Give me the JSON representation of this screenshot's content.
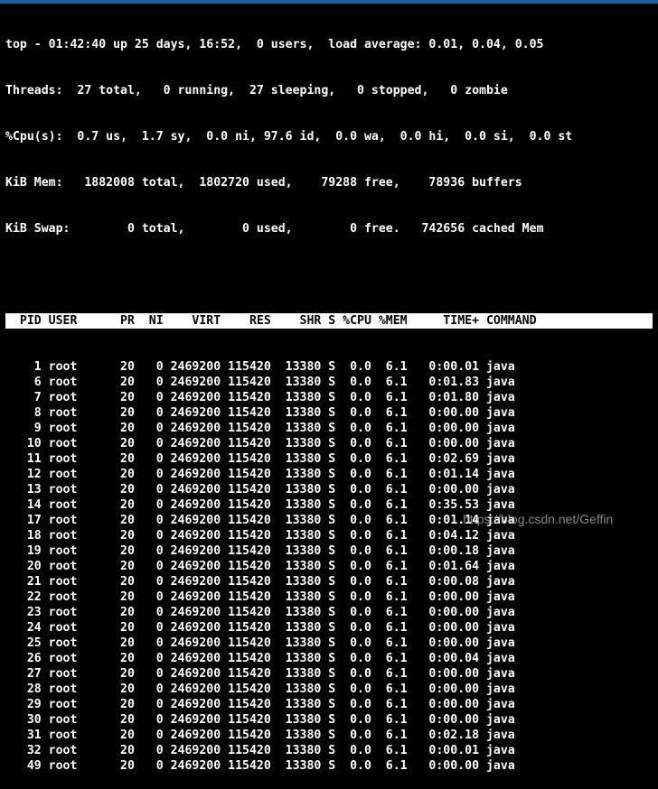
{
  "colors": {
    "background": "#000000",
    "text": "#ffffff",
    "header_bg": "#ffffff",
    "header_text": "#000000",
    "window_bar": "#1a5fa6"
  },
  "summary": [
    "top - 01:42:40 up 25 days, 16:52,  0 users,  load average: 0.01, 0.04, 0.05",
    "Threads:  27 total,   0 running,  27 sleeping,   0 stopped,   0 zombie",
    "%Cpu(s):  0.7 us,  1.7 sy,  0.0 ni, 97.6 id,  0.0 wa,  0.0 hi,  0.0 si,  0.0 st",
    "KiB Mem:   1882008 total,  1802720 used,    79288 free,    78936 buffers",
    "KiB Swap:        0 total,        0 used,        0 free.   742656 cached Mem"
  ],
  "table": {
    "header": "  PID USER      PR  NI    VIRT    RES    SHR S %CPU %MEM     TIME+ COMMAND",
    "rows": [
      [
        "1",
        "root",
        "20",
        "0",
        "2469200",
        "115420",
        "13380",
        "S",
        "0.0",
        "6.1",
        "0:00.01",
        "java"
      ],
      [
        "6",
        "root",
        "20",
        "0",
        "2469200",
        "115420",
        "13380",
        "S",
        "0.0",
        "6.1",
        "0:01.83",
        "java"
      ],
      [
        "7",
        "root",
        "20",
        "0",
        "2469200",
        "115420",
        "13380",
        "S",
        "0.0",
        "6.1",
        "0:01.80",
        "java"
      ],
      [
        "8",
        "root",
        "20",
        "0",
        "2469200",
        "115420",
        "13380",
        "S",
        "0.0",
        "6.1",
        "0:00.00",
        "java"
      ],
      [
        "9",
        "root",
        "20",
        "0",
        "2469200",
        "115420",
        "13380",
        "S",
        "0.0",
        "6.1",
        "0:00.00",
        "java"
      ],
      [
        "10",
        "root",
        "20",
        "0",
        "2469200",
        "115420",
        "13380",
        "S",
        "0.0",
        "6.1",
        "0:00.00",
        "java"
      ],
      [
        "11",
        "root",
        "20",
        "0",
        "2469200",
        "115420",
        "13380",
        "S",
        "0.0",
        "6.1",
        "0:02.69",
        "java"
      ],
      [
        "12",
        "root",
        "20",
        "0",
        "2469200",
        "115420",
        "13380",
        "S",
        "0.0",
        "6.1",
        "0:01.14",
        "java"
      ],
      [
        "13",
        "root",
        "20",
        "0",
        "2469200",
        "115420",
        "13380",
        "S",
        "0.0",
        "6.1",
        "0:00.00",
        "java"
      ],
      [
        "14",
        "root",
        "20",
        "0",
        "2469200",
        "115420",
        "13380",
        "S",
        "0.0",
        "6.1",
        "0:35.53",
        "java"
      ],
      [
        "17",
        "root",
        "20",
        "0",
        "2469200",
        "115420",
        "13380",
        "S",
        "0.0",
        "6.1",
        "0:01.14",
        "java"
      ],
      [
        "18",
        "root",
        "20",
        "0",
        "2469200",
        "115420",
        "13380",
        "S",
        "0.0",
        "6.1",
        "0:04.12",
        "java"
      ],
      [
        "19",
        "root",
        "20",
        "0",
        "2469200",
        "115420",
        "13380",
        "S",
        "0.0",
        "6.1",
        "0:00.18",
        "java"
      ],
      [
        "20",
        "root",
        "20",
        "0",
        "2469200",
        "115420",
        "13380",
        "S",
        "0.0",
        "6.1",
        "0:01.64",
        "java"
      ],
      [
        "21",
        "root",
        "20",
        "0",
        "2469200",
        "115420",
        "13380",
        "S",
        "0.0",
        "6.1",
        "0:00.08",
        "java"
      ],
      [
        "22",
        "root",
        "20",
        "0",
        "2469200",
        "115420",
        "13380",
        "S",
        "0.0",
        "6.1",
        "0:00.00",
        "java"
      ],
      [
        "23",
        "root",
        "20",
        "0",
        "2469200",
        "115420",
        "13380",
        "S",
        "0.0",
        "6.1",
        "0:00.00",
        "java"
      ],
      [
        "24",
        "root",
        "20",
        "0",
        "2469200",
        "115420",
        "13380",
        "S",
        "0.0",
        "6.1",
        "0:00.00",
        "java"
      ],
      [
        "25",
        "root",
        "20",
        "0",
        "2469200",
        "115420",
        "13380",
        "S",
        "0.0",
        "6.1",
        "0:00.00",
        "java"
      ],
      [
        "26",
        "root",
        "20",
        "0",
        "2469200",
        "115420",
        "13380",
        "S",
        "0.0",
        "6.1",
        "0:00.04",
        "java"
      ],
      [
        "27",
        "root",
        "20",
        "0",
        "2469200",
        "115420",
        "13380",
        "S",
        "0.0",
        "6.1",
        "0:00.00",
        "java"
      ],
      [
        "28",
        "root",
        "20",
        "0",
        "2469200",
        "115420",
        "13380",
        "S",
        "0.0",
        "6.1",
        "0:00.00",
        "java"
      ],
      [
        "29",
        "root",
        "20",
        "0",
        "2469200",
        "115420",
        "13380",
        "S",
        "0.0",
        "6.1",
        "0:00.00",
        "java"
      ],
      [
        "30",
        "root",
        "20",
        "0",
        "2469200",
        "115420",
        "13380",
        "S",
        "0.0",
        "6.1",
        "0:00.00",
        "java"
      ],
      [
        "31",
        "root",
        "20",
        "0",
        "2469200",
        "115420",
        "13380",
        "S",
        "0.0",
        "6.1",
        "0:02.18",
        "java"
      ],
      [
        "32",
        "root",
        "20",
        "0",
        "2469200",
        "115420",
        "13380",
        "S",
        "0.0",
        "6.1",
        "0:00.01",
        "java"
      ],
      [
        "49",
        "root",
        "20",
        "0",
        "2469200",
        "115420",
        "13380",
        "S",
        "0.0",
        "6.1",
        "0:00.00",
        "java"
      ]
    ]
  },
  "watermark": "https://blog.csdn.net/Geffin"
}
